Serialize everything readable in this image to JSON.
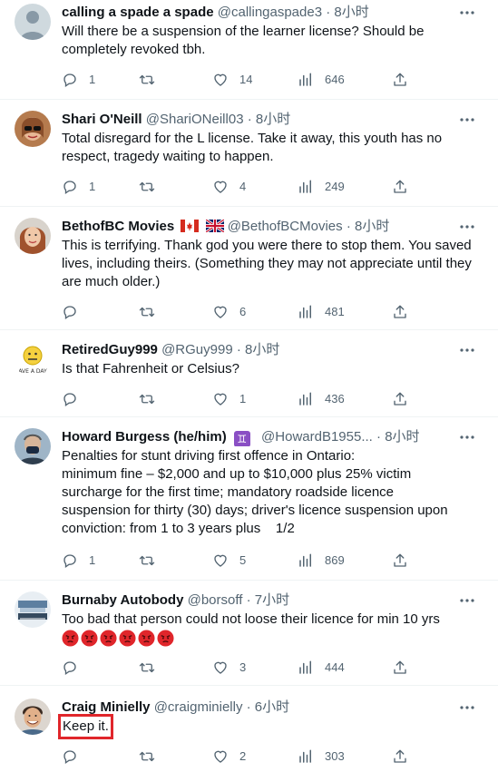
{
  "tweets": [
    {
      "name": "calling a spade a spade",
      "handle": "@callingaspade3",
      "time": "8小时",
      "text": "Will there be a suspension of the learner license? Should be completely revoked tbh.",
      "replies": "1",
      "retweets": "",
      "likes": "14",
      "views": "646",
      "avatar": "default-avatar-icon"
    },
    {
      "name": "Shari O'Neill",
      "handle": "@ShariONeill03",
      "time": "8小时",
      "text": "Total disregard for the L license. Take it away, this youth has no respect, tragedy waiting to happen.",
      "replies": "1",
      "retweets": "",
      "likes": "4",
      "views": "249",
      "avatar": "woman-sunglasses-avatar"
    },
    {
      "name": "BethofBC Movies",
      "handle": "@BethofBCMovies",
      "time": "8小时",
      "text": "This is terrifying. Thank god you were there to stop them. You saved lives, including theirs. (Something they may not appreciate until they are much older.)",
      "replies": "",
      "retweets": "",
      "likes": "6",
      "views": "481",
      "flags": [
        "canada-flag-icon",
        "uk-flag-icon"
      ],
      "avatar": "woman-avatar"
    },
    {
      "name": "RetiredGuy999",
      "handle": "@RGuy999",
      "time": "8小时",
      "text": "Is that Fahrenheit or Celsius?",
      "replies": "",
      "retweets": "",
      "likes": "1",
      "views": "436",
      "avatar_text": "AVE A DAY",
      "avatar": "neutral-face-avatar"
    },
    {
      "name": "Howard Burgess (he/him)",
      "handle": "@HowardB1955...",
      "time": "8小时",
      "zodiac": "♊",
      "text_lines": [
        "Penalties for stunt driving first offence in Ontario:",
        "minimum fine – $2,000 and up to $10,000 plus 25% victim",
        "surcharge for the first time; mandatory roadside licence",
        "suspension for thirty (30) days; driver's licence suspension upon",
        "conviction: from 1 to 3 years plus    1/2"
      ],
      "replies": "1",
      "retweets": "",
      "likes": "5",
      "views": "869",
      "avatar": "man-mask-avatar"
    },
    {
      "name": "Burnaby Autobody",
      "handle": "@borsoff",
      "time": "7小时",
      "text": "Too bad that person could not loose their licence for min 10 yrs",
      "emojis": [
        "angry-face-icon",
        "angry-face-icon",
        "angry-face-icon",
        "angry-face-icon",
        "angry-face-icon",
        "angry-face-icon"
      ],
      "replies": "",
      "retweets": "",
      "likes": "3",
      "views": "444",
      "avatar": "autobody-logo-avatar"
    },
    {
      "name": "Craig Minielly",
      "handle": "@craigminielly",
      "time": "6小时",
      "text": "Keep it.",
      "replies": "",
      "retweets": "",
      "likes": "2",
      "views": "303",
      "avatar": "man-smiling-avatar"
    }
  ],
  "colors": {
    "text": "#0f1419",
    "muted": "#536471",
    "border": "#eff3f4",
    "highlight": "#e0262b"
  },
  "icons": {
    "reply": "reply-icon",
    "retweet": "retweet-icon",
    "like": "heart-icon",
    "views": "views-icon",
    "share": "share-icon",
    "more": "more-icon"
  }
}
